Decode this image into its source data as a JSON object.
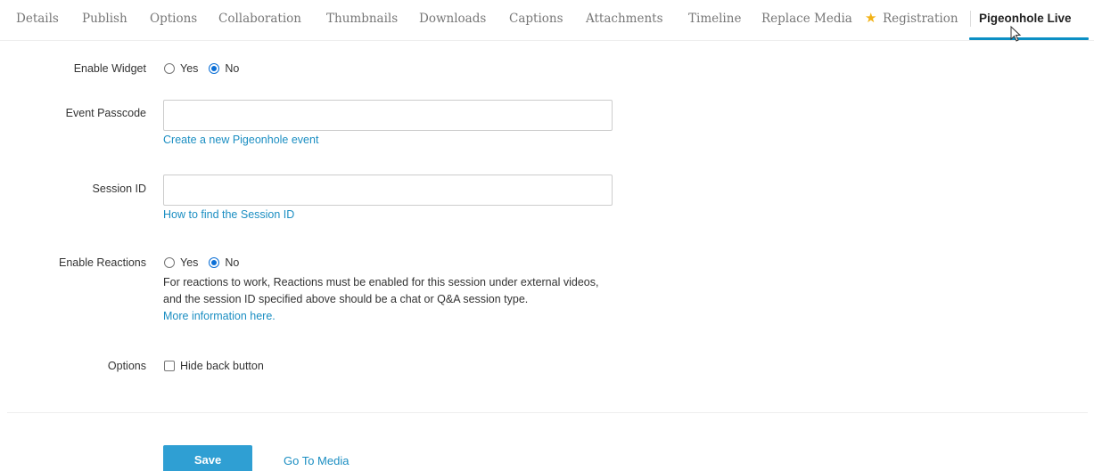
{
  "tabs": [
    {
      "label": "Details"
    },
    {
      "label": "Publish"
    },
    {
      "label": "Options"
    },
    {
      "label": "Collaboration"
    },
    {
      "label": "Thumbnails"
    },
    {
      "label": "Downloads"
    },
    {
      "label": "Captions"
    },
    {
      "label": "Attachments"
    },
    {
      "label": "Timeline"
    },
    {
      "label": "Replace Media"
    },
    {
      "label": "Registration"
    },
    {
      "label": "Pigeonhole Live"
    }
  ],
  "active_tab": "Pigeonhole Live",
  "accent_color": "#0b8fc4",
  "star_icon": "★",
  "form": {
    "enable_widget": {
      "label": "Enable Widget",
      "yes": "Yes",
      "no": "No",
      "selected": "No"
    },
    "event_passcode": {
      "label": "Event Passcode",
      "value": "",
      "link": "Create a new Pigeonhole event"
    },
    "session_id": {
      "label": "Session ID",
      "value": "",
      "link": "How to find the Session ID"
    },
    "enable_reactions": {
      "label": "Enable Reactions",
      "yes": "Yes",
      "no": "No",
      "selected": "No",
      "help_line1": "For reactions to work, Reactions must be enabled for this session under external videos,",
      "help_line2": "and the session ID specified above should be a chat or Q&A session type.",
      "link": "More information here."
    },
    "options": {
      "label": "Options",
      "hide_back_button": "Hide back button",
      "hide_back_checked": false
    }
  },
  "actions": {
    "save": "Save",
    "go_to_media": "Go To Media"
  }
}
